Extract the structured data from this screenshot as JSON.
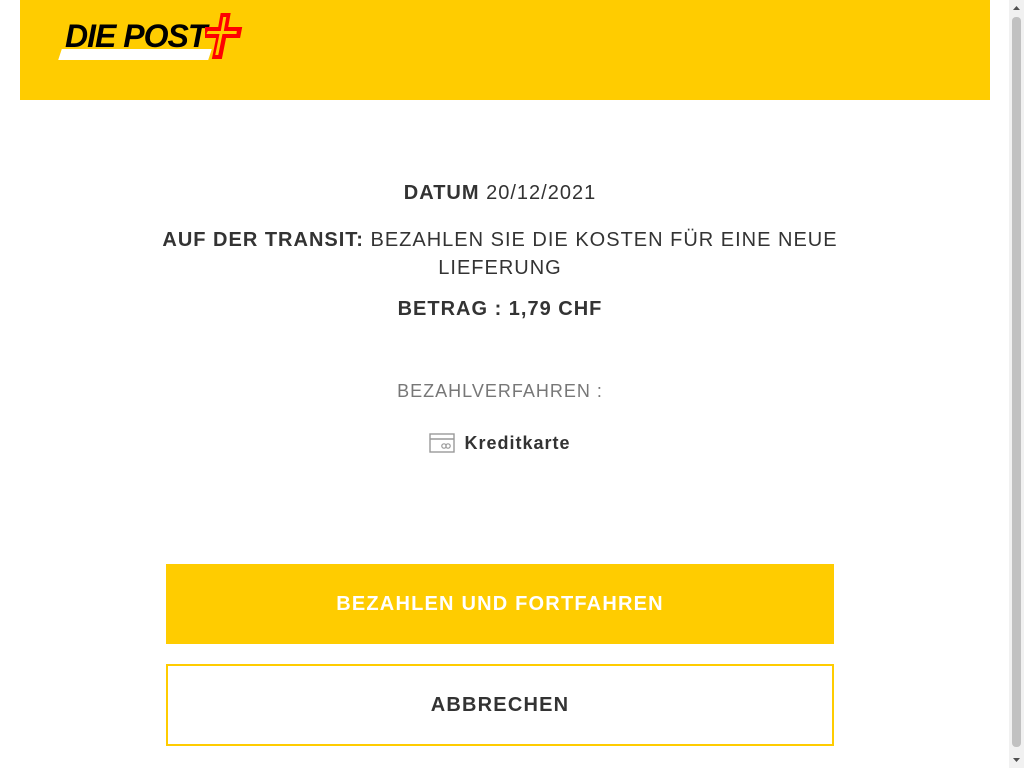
{
  "header": {
    "brand": "DIE POST",
    "brand_color": "#ffcc00",
    "cross_color": "#ff0000",
    "cross_icon": "swiss-cross-icon"
  },
  "info": {
    "date_label": "DATUM",
    "date_value": "20/12/2021",
    "transit_label": "AUF DER TRANSIT:",
    "transit_text": "BEZAHLEN SIE DIE KOSTEN FÜR EINE NEUE LIEFERUNG",
    "amount": "BETRAG : 1,79 CHF"
  },
  "payment": {
    "method_label": "BEZAHLVERFAHREN :",
    "method_name": "Kreditkarte",
    "method_icon": "credit-card-icon"
  },
  "actions": {
    "pay_label": "BEZAHLEN UND FORTFAHREN",
    "cancel_label": "ABBRECHEN"
  }
}
